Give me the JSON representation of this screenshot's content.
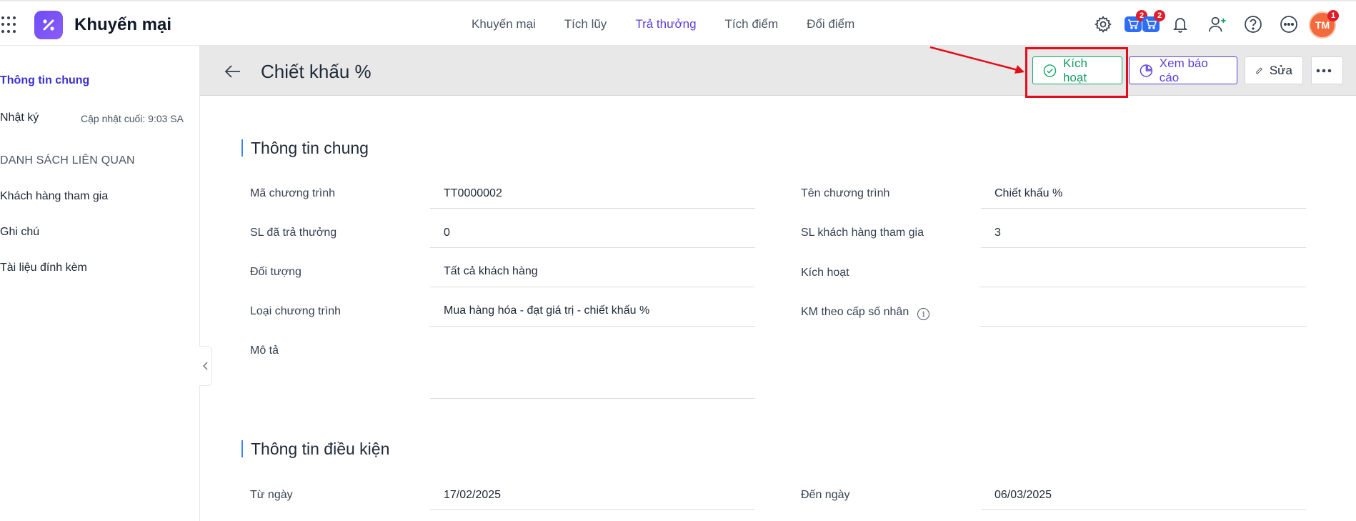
{
  "app": {
    "title": "Khuyến mại"
  },
  "nav": {
    "items": [
      {
        "label": "Khuyến mại"
      },
      {
        "label": "Tích lũy"
      },
      {
        "label": "Trả thưởng"
      },
      {
        "label": "Tích điểm"
      },
      {
        "label": "Đổi điểm"
      }
    ],
    "active_index": 2
  },
  "top_icons": {
    "cart1_badge": "2",
    "cart2_badge": "2",
    "avatar_initials": "TM",
    "avatar_badge": "1"
  },
  "sidebar": {
    "general_info": "Thông tin chung",
    "log": "Nhật ký",
    "log_meta": "Cập nhật cuối: 9:03 SA",
    "related_heading": "DANH SÁCH LIÊN QUAN",
    "participants": "Khách hàng tham gia",
    "notes": "Ghi chú",
    "attachments": "Tài liệu đính kèm"
  },
  "header": {
    "title": "Chiết khấu %",
    "activate_label": "Kích hoạt",
    "report_label": "Xem báo cáo",
    "edit_label": "Sửa"
  },
  "general": {
    "section_title": "Thông tin chung",
    "fields": {
      "program_code": {
        "label": "Mã chương trình",
        "value": "TT0000002"
      },
      "program_name": {
        "label": "Tên chương trình",
        "value": "Chiết khấu %"
      },
      "rewarded_count": {
        "label": "SL đã trả thưởng",
        "value": "0"
      },
      "participant_count": {
        "label": "SL khách hàng tham gia",
        "value": "3"
      },
      "target": {
        "label": "Đối tượng",
        "value": "Tất cả khách hàng"
      },
      "activation": {
        "label": "Kích hoạt",
        "value": ""
      },
      "program_type": {
        "label": "Loại chương trình",
        "value": "Mua hàng hóa - đạt giá trị - chiết khấu %"
      },
      "multiplier": {
        "label": "KM theo cấp số nhân",
        "value": ""
      },
      "description": {
        "label": "Mô tả",
        "value": ""
      }
    }
  },
  "conditions": {
    "section_title": "Thông tin điều kiện",
    "fields": {
      "from_date": {
        "label": "Từ ngày",
        "value": "17/02/2025"
      },
      "to_date": {
        "label": "Đến ngày",
        "value": "06/03/2025"
      }
    }
  },
  "colors": {
    "brand": "#5b3fd6",
    "success": "#16a36a",
    "annotation": "#e30d17"
  }
}
